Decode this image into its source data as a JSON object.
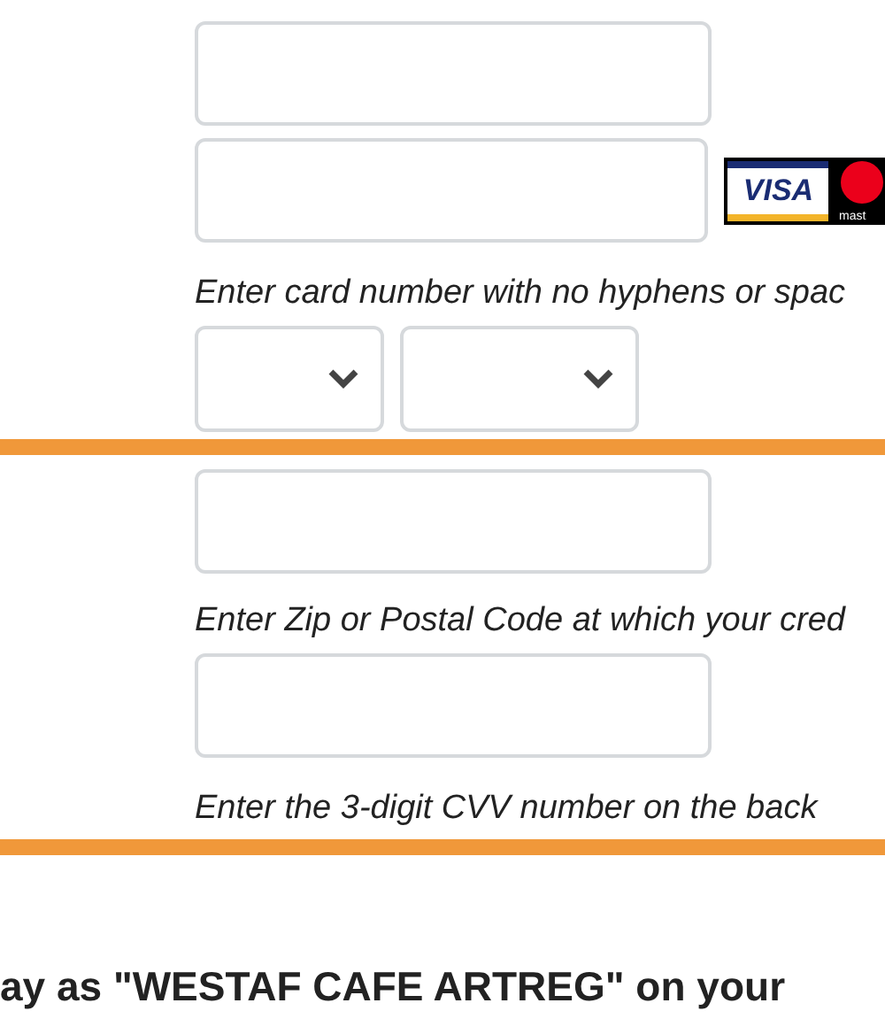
{
  "card_logos": [
    {
      "kind": "visa",
      "label": "VISA"
    },
    {
      "kind": "mastercard",
      "label": "mast"
    }
  ],
  "card_number_hint": "Enter card number with no hyphens or spac",
  "expiry_selects": [
    {
      "kind": "month"
    },
    {
      "kind": "year"
    }
  ],
  "zip_hint": "Enter Zip or Postal Code at which your cred",
  "cvv_hint": "Enter the 3-digit CVV number on the back",
  "statement_note": "ay as \"WESTAF CAFE ARTREG\" on your"
}
